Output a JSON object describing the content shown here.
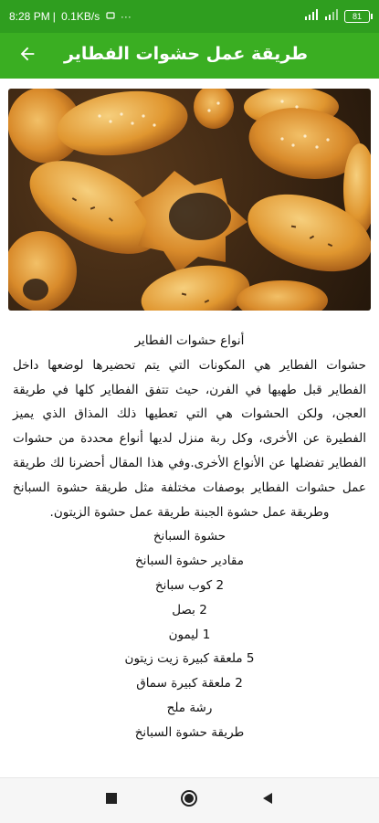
{
  "status_bar": {
    "time": "8:28 PM",
    "speed": "0.1KB/s",
    "more": "···",
    "battery": "81"
  },
  "app_bar": {
    "title": "طريقة عمل حشوات الفطاير",
    "back_icon": "arrow-back-icon"
  },
  "hero_image": {
    "subject": "baked stuffed pastries with sesame and black seeds"
  },
  "article": {
    "heading": "أنواع حشوات الفطاير",
    "intro": "حشوات الفطاير هي المكونات التي يتم تحضيرها لوضعها داخل الفطاير قبل طهيها في الفرن، حيث تتفق الفطاير كلها في طريقة العجن، ولكن الحشوات هي التي تعطيها ذلك المذاق الذي يميز الفطيرة عن الأخرى، وكل ربة منزل لديها أنواع محددة من حشوات الفطاير تفضلها عن الأنواع الأخرى.وفي هذا المقال أحضرنا لك طريقة عمل حشوات الفطاير بوصفات مختلفة مثل طريقة حشوة السبانخ وطريقة عمل حشوة الجبنة طريقة عمل حشوة الزيتون.",
    "lines": [
      "حشوة السبانخ",
      "مقادير حشوة السبانخ",
      "2 كوب سبانخ",
      "2 بصل",
      "1 ليمون",
      "5 ملعقة كبيرة زيت زيتون",
      "2 ملعقة كبيرة سماق",
      "رشة ملح",
      "طريقة حشوة السبانخ"
    ]
  },
  "colors": {
    "status_bar": "#2f9e1f",
    "app_bar": "#3aae22",
    "nav_bar": "#f6f6f6"
  }
}
